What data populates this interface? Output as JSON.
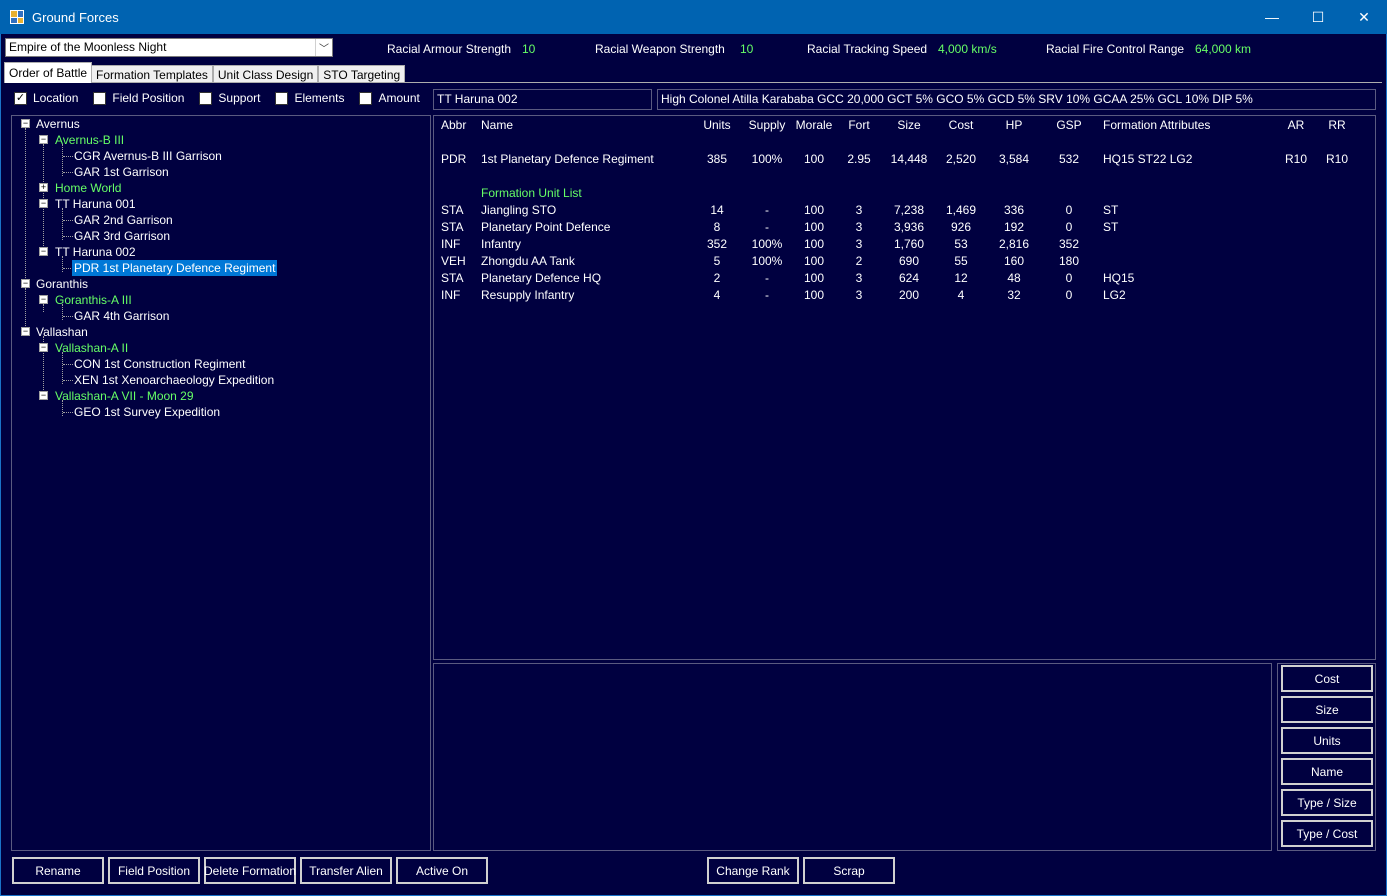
{
  "window": {
    "title": "Ground Forces",
    "minimize": "—",
    "maximize": "☐",
    "close": "✕"
  },
  "empire": {
    "selected": "Empire of the Moonless Night"
  },
  "racial": {
    "armour_label": "Racial Armour Strength",
    "armour_value": "10",
    "weapon_label": "Racial Weapon Strength",
    "weapon_value": "10",
    "tracking_label": "Racial Tracking Speed",
    "tracking_value": "4,000 km/s",
    "firecontrol_label": "Racial Fire Control Range",
    "firecontrol_value": "64,000 km"
  },
  "tabs": [
    "Order of Battle",
    "Formation Templates",
    "Unit Class Design",
    "STO Targeting"
  ],
  "filters": [
    {
      "label": "Location",
      "checked": true
    },
    {
      "label": "Field Position",
      "checked": false
    },
    {
      "label": "Support",
      "checked": false
    },
    {
      "label": "Elements",
      "checked": false
    },
    {
      "label": "Amount",
      "checked": false
    }
  ],
  "tree": [
    {
      "label": "Avernus",
      "level": 0
    },
    {
      "label": "Avernus-B III",
      "level": 1,
      "green": true
    },
    {
      "label": "CGR Avernus-B III Garrison",
      "level": 2
    },
    {
      "label": "GAR 1st Garrison",
      "level": 2
    },
    {
      "label": "Home World",
      "level": 1,
      "green": true,
      "collapsed": true
    },
    {
      "label": "TT Haruna 001",
      "level": 1
    },
    {
      "label": "GAR 2nd Garrison",
      "level": 2
    },
    {
      "label": "GAR 3rd Garrison",
      "level": 2
    },
    {
      "label": "TT Haruna 002",
      "level": 1
    },
    {
      "label": "PDR 1st Planetary Defence Regiment",
      "level": 2,
      "selected": true
    },
    {
      "label": "Goranthis",
      "level": 0
    },
    {
      "label": "Goranthis-A III",
      "level": 1,
      "green": true
    },
    {
      "label": "GAR 4th Garrison",
      "level": 2
    },
    {
      "label": "Vallashan",
      "level": 0
    },
    {
      "label": "Vallashan-A II",
      "level": 1,
      "green": true
    },
    {
      "label": "CON 1st Construction Regiment",
      "level": 2
    },
    {
      "label": "XEN 1st Xenoarchaeology Expedition",
      "level": 2
    },
    {
      "label": "Vallashan-A VII - Moon 29",
      "level": 1,
      "green": true
    },
    {
      "label": "GEO 1st Survey Expedition",
      "level": 2
    }
  ],
  "formation": {
    "location": "TT Haruna 002",
    "commander": "High Colonel Atilla Karababa   GCC 20,000   GCT 5%   GCO 5%   GCD 5%   SRV 10%   GCAA 25%   GCL 10%   DIP 5%"
  },
  "table": {
    "headers": [
      "Abbr",
      "Name",
      "Units",
      "Supply",
      "Morale",
      "Fort",
      "Size",
      "Cost",
      "HP",
      "GSP",
      "Formation Attributes",
      "AR",
      "RR"
    ],
    "formation_row": [
      "PDR",
      "1st Planetary Defence Regiment",
      "385",
      "100%",
      "100",
      "2.95",
      "14,448",
      "2,520",
      "3,584",
      "532",
      "HQ15  ST22  LG2",
      "R10",
      "R10"
    ],
    "unit_list_label": "Formation Unit List",
    "rows": [
      [
        "STA",
        "Jiangling  STO",
        "14",
        "-",
        "100",
        "3",
        "7,238",
        "1,469",
        "336",
        "0",
        "ST"
      ],
      [
        "STA",
        "Planetary Point Defence",
        "8",
        "-",
        "100",
        "3",
        "3,936",
        "926",
        "192",
        "0",
        "ST"
      ],
      [
        "INF",
        "Infantry",
        "352",
        "100%",
        "100",
        "3",
        "1,760",
        "53",
        "2,816",
        "352",
        ""
      ],
      [
        "VEH",
        "Zhongdu  AA Tank",
        "5",
        "100%",
        "100",
        "2",
        "690",
        "55",
        "160",
        "180",
        ""
      ],
      [
        "STA",
        "Planetary Defence HQ",
        "2",
        "-",
        "100",
        "3",
        "624",
        "12",
        "48",
        "0",
        "HQ15"
      ],
      [
        "INF",
        "Resupply Infantry",
        "4",
        "-",
        "100",
        "3",
        "200",
        "4",
        "32",
        "0",
        "LG2"
      ]
    ]
  },
  "sort_buttons": [
    "Cost",
    "Size",
    "Units",
    "Name",
    "Type / Size",
    "Type / Cost"
  ],
  "bottom_buttons": [
    "Rename",
    "Field Position",
    "Delete Formation",
    "Transfer Alien",
    "Active On",
    "Change Rank",
    "Scrap"
  ],
  "colors": {
    "background": "#000040",
    "titlebar": "#0063b1",
    "highlight_green": "#66ff66",
    "selection": "#0078d7"
  }
}
